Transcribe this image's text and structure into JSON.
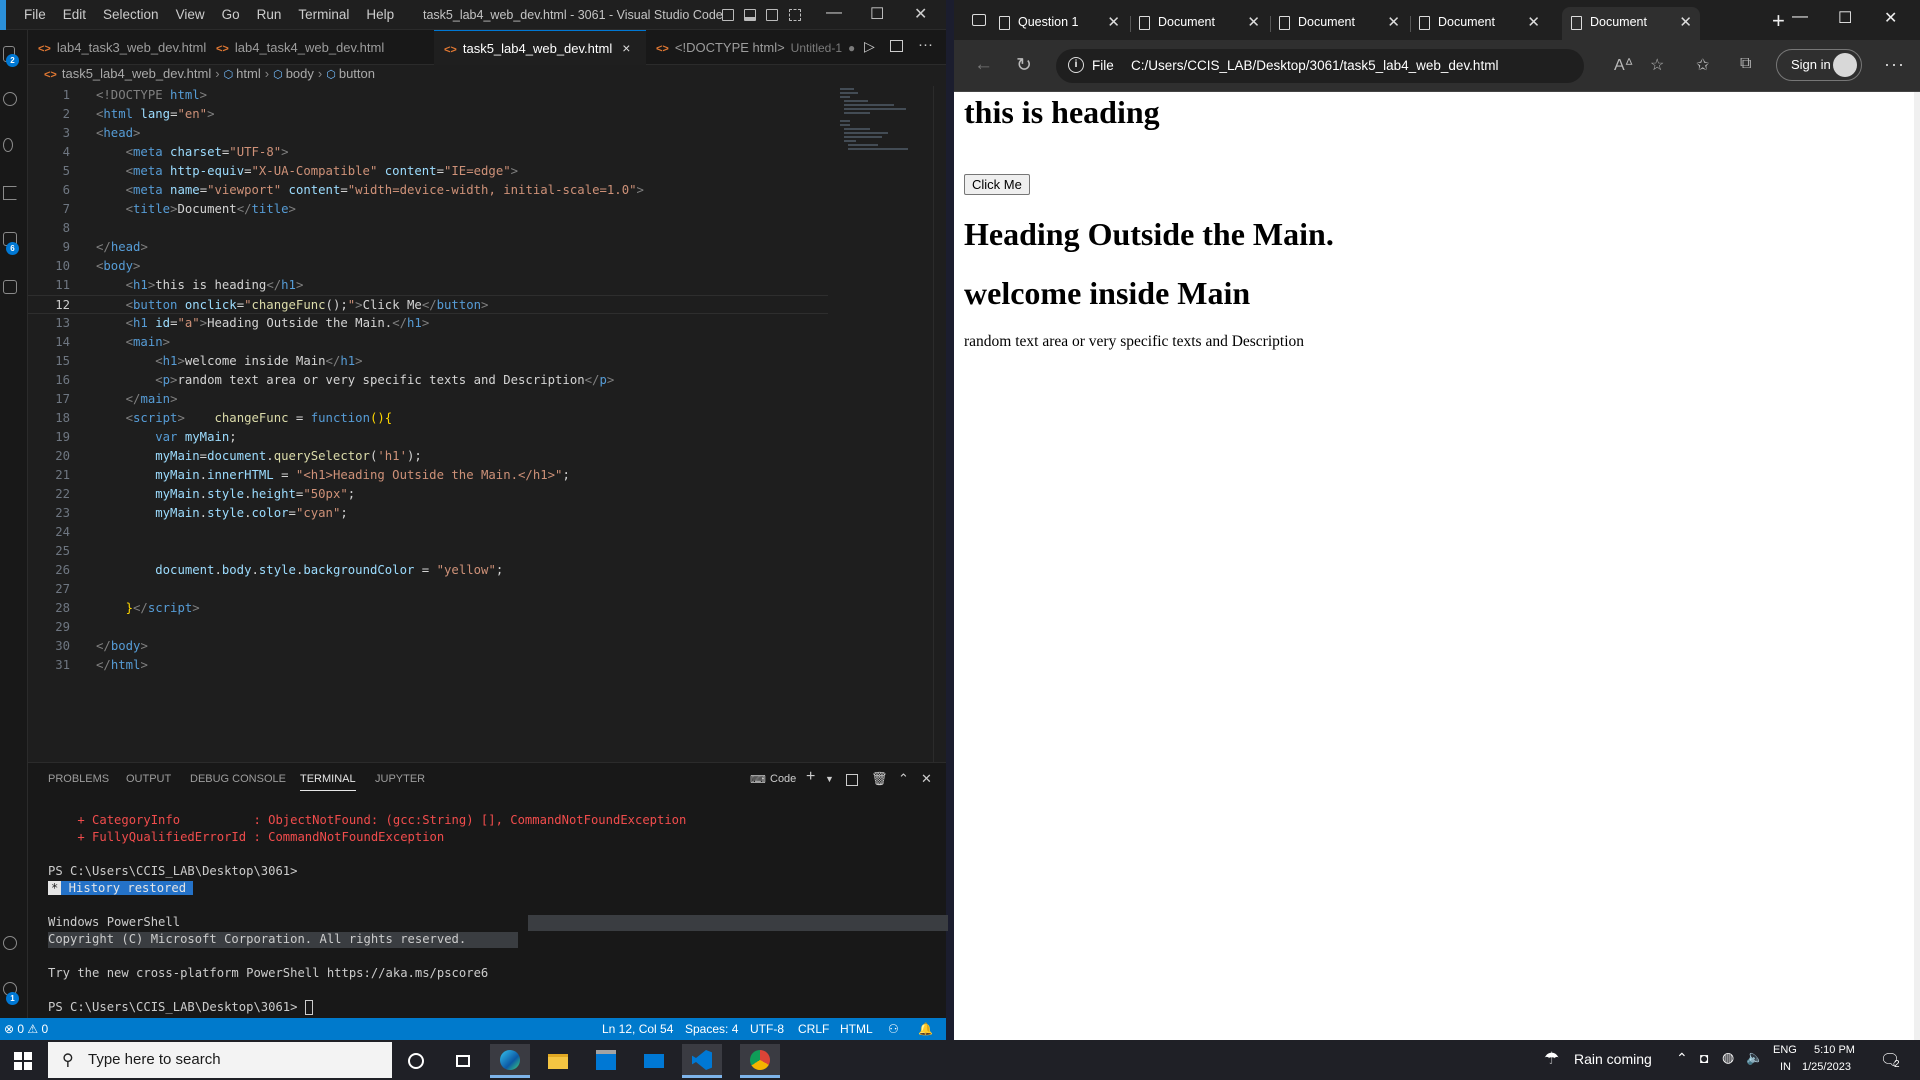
{
  "vscode": {
    "menu": [
      "File",
      "Edit",
      "Selection",
      "View",
      "Go",
      "Run",
      "Terminal",
      "Help"
    ],
    "window_title": "task5_lab4_web_dev.html - 3061 - Visual Studio Code",
    "badges": {
      "source_control": "2",
      "extensions": "6",
      "settings": "1"
    },
    "tabs": [
      {
        "label": "lab4_task3_web_dev.html"
      },
      {
        "label": "lab4_task4_web_dev.html"
      },
      {
        "label": "task5_lab4_web_dev.html",
        "close": "×"
      },
      {
        "label": "<!DOCTYPE html>",
        "sub": "Untitled-1",
        "dirty": "●"
      }
    ],
    "breadcrumb": {
      "file": "task5_lab4_web_dev.html",
      "items": [
        "html",
        "body",
        "button"
      ]
    },
    "code_lines": [
      {
        "n": "1",
        "parts": [
          [
            "t",
            "<!DOCTYPE "
          ],
          [
            "tg",
            "html"
          ],
          [
            "t",
            ">"
          ]
        ]
      },
      {
        "n": "2",
        "parts": [
          [
            "t",
            "<"
          ],
          [
            "tg",
            "html"
          ],
          [
            "at",
            " lang"
          ],
          [
            "tx",
            "="
          ],
          [
            "st",
            "\"en\""
          ],
          [
            "t",
            ">"
          ]
        ]
      },
      {
        "n": "3",
        "parts": [
          [
            "t",
            "<"
          ],
          [
            "tg",
            "head"
          ],
          [
            "t",
            ">"
          ]
        ]
      },
      {
        "n": "4",
        "parts": [
          [
            "tx",
            "    "
          ],
          [
            "t",
            "<"
          ],
          [
            "tg",
            "meta"
          ],
          [
            "at",
            " charset"
          ],
          [
            "tx",
            "="
          ],
          [
            "st",
            "\"UTF-8\""
          ],
          [
            "t",
            ">"
          ]
        ]
      },
      {
        "n": "5",
        "parts": [
          [
            "tx",
            "    "
          ],
          [
            "t",
            "<"
          ],
          [
            "tg",
            "meta"
          ],
          [
            "at",
            " http-equiv"
          ],
          [
            "tx",
            "="
          ],
          [
            "st",
            "\"X-UA-Compatible\""
          ],
          [
            "at",
            " content"
          ],
          [
            "tx",
            "="
          ],
          [
            "st",
            "\"IE=edge\""
          ],
          [
            "t",
            ">"
          ]
        ]
      },
      {
        "n": "6",
        "parts": [
          [
            "tx",
            "    "
          ],
          [
            "t",
            "<"
          ],
          [
            "tg",
            "meta"
          ],
          [
            "at",
            " name"
          ],
          [
            "tx",
            "="
          ],
          [
            "st",
            "\"viewport\""
          ],
          [
            "at",
            " content"
          ],
          [
            "tx",
            "="
          ],
          [
            "st",
            "\"width=device-width, initial-scale=1.0\""
          ],
          [
            "t",
            ">"
          ]
        ]
      },
      {
        "n": "7",
        "parts": [
          [
            "tx",
            "    "
          ],
          [
            "t",
            "<"
          ],
          [
            "tg",
            "title"
          ],
          [
            "t",
            ">"
          ],
          [
            "tx",
            "Document"
          ],
          [
            "t",
            "</"
          ],
          [
            "tg",
            "title"
          ],
          [
            "t",
            ">"
          ]
        ]
      },
      {
        "n": "8",
        "parts": []
      },
      {
        "n": "9",
        "parts": [
          [
            "t",
            "</"
          ],
          [
            "tg",
            "head"
          ],
          [
            "t",
            ">"
          ]
        ]
      },
      {
        "n": "10",
        "parts": [
          [
            "t",
            "<"
          ],
          [
            "tg",
            "body"
          ],
          [
            "t",
            ">"
          ]
        ]
      },
      {
        "n": "11",
        "parts": [
          [
            "tx",
            "    "
          ],
          [
            "t",
            "<"
          ],
          [
            "tg",
            "h1"
          ],
          [
            "t",
            ">"
          ],
          [
            "tx",
            "this is heading"
          ],
          [
            "t",
            "</"
          ],
          [
            "tg",
            "h1"
          ],
          [
            "t",
            ">"
          ]
        ]
      },
      {
        "n": "12",
        "parts": [
          [
            "tx",
            "    "
          ],
          [
            "t",
            "<"
          ],
          [
            "tg",
            "button"
          ],
          [
            "at",
            " onclick"
          ],
          [
            "tx",
            "="
          ],
          [
            "st",
            "\""
          ],
          [
            "fn",
            "changeFunc"
          ],
          [
            "tx",
            "();"
          ],
          [
            "st",
            "\""
          ],
          [
            "t",
            ">"
          ],
          [
            "tx",
            "Click Me"
          ],
          [
            "t",
            "</"
          ],
          [
            "tg",
            "button"
          ],
          [
            "t",
            ">"
          ]
        ]
      },
      {
        "n": "13",
        "parts": [
          [
            "tx",
            "    "
          ],
          [
            "t",
            "<"
          ],
          [
            "tg",
            "h1"
          ],
          [
            "at",
            " id"
          ],
          [
            "tx",
            "="
          ],
          [
            "st",
            "\"a\""
          ],
          [
            "t",
            ">"
          ],
          [
            "tx",
            "Heading Outside the Main."
          ],
          [
            "t",
            "</"
          ],
          [
            "tg",
            "h1"
          ],
          [
            "t",
            ">"
          ]
        ]
      },
      {
        "n": "14",
        "parts": [
          [
            "tx",
            "    "
          ],
          [
            "t",
            "<"
          ],
          [
            "tg",
            "main"
          ],
          [
            "t",
            ">"
          ]
        ]
      },
      {
        "n": "15",
        "parts": [
          [
            "tx",
            "        "
          ],
          [
            "t",
            "<"
          ],
          [
            "tg",
            "h1"
          ],
          [
            "t",
            ">"
          ],
          [
            "tx",
            "welcome inside Main"
          ],
          [
            "t",
            "</"
          ],
          [
            "tg",
            "h1"
          ],
          [
            "t",
            ">"
          ]
        ]
      },
      {
        "n": "16",
        "parts": [
          [
            "tx",
            "        "
          ],
          [
            "t",
            "<"
          ],
          [
            "tg",
            "p"
          ],
          [
            "t",
            ">"
          ],
          [
            "tx",
            "random text area or very specific texts and Description"
          ],
          [
            "t",
            "</"
          ],
          [
            "tg",
            "p"
          ],
          [
            "t",
            ">"
          ]
        ]
      },
      {
        "n": "17",
        "parts": [
          [
            "tx",
            "    "
          ],
          [
            "t",
            "</"
          ],
          [
            "tg",
            "main"
          ],
          [
            "t",
            ">"
          ]
        ]
      },
      {
        "n": "18",
        "parts": [
          [
            "tx",
            "    "
          ],
          [
            "t",
            "<"
          ],
          [
            "tg",
            "script"
          ],
          [
            "t",
            ">"
          ],
          [
            "tx",
            "    "
          ],
          [
            "fn",
            "changeFunc"
          ],
          [
            "tx",
            " = "
          ],
          [
            "kw",
            "function"
          ],
          [
            "br",
            "(){"
          ]
        ]
      },
      {
        "n": "19",
        "parts": [
          [
            "tx",
            "        "
          ],
          [
            "kw",
            "var"
          ],
          [
            "at",
            " myMain"
          ],
          [
            "tx",
            ";"
          ]
        ]
      },
      {
        "n": "20",
        "parts": [
          [
            "tx",
            "        "
          ],
          [
            "at",
            "myMain"
          ],
          [
            "tx",
            "="
          ],
          [
            "at",
            "document"
          ],
          [
            "tx",
            "."
          ],
          [
            "fn",
            "querySelector"
          ],
          [
            "tx",
            "("
          ],
          [
            "st",
            "'h1'"
          ],
          [
            "tx",
            ");"
          ]
        ]
      },
      {
        "n": "21",
        "parts": [
          [
            "tx",
            "        "
          ],
          [
            "at",
            "myMain"
          ],
          [
            "tx",
            "."
          ],
          [
            "at",
            "innerHTML"
          ],
          [
            "tx",
            " = "
          ],
          [
            "st",
            "\"<h1>Heading Outside the Main.</h1>\""
          ],
          [
            "tx",
            ";"
          ]
        ]
      },
      {
        "n": "22",
        "parts": [
          [
            "tx",
            "        "
          ],
          [
            "at",
            "myMain"
          ],
          [
            "tx",
            "."
          ],
          [
            "at",
            "style"
          ],
          [
            "tx",
            "."
          ],
          [
            "at",
            "height"
          ],
          [
            "tx",
            "="
          ],
          [
            "st",
            "\"50px\""
          ],
          [
            "tx",
            ";"
          ]
        ]
      },
      {
        "n": "23",
        "parts": [
          [
            "tx",
            "        "
          ],
          [
            "at",
            "myMain"
          ],
          [
            "tx",
            "."
          ],
          [
            "at",
            "style"
          ],
          [
            "tx",
            "."
          ],
          [
            "at",
            "color"
          ],
          [
            "tx",
            "="
          ],
          [
            "st",
            "\"cyan\""
          ],
          [
            "tx",
            ";"
          ]
        ]
      },
      {
        "n": "24",
        "parts": []
      },
      {
        "n": "25",
        "parts": []
      },
      {
        "n": "26",
        "parts": [
          [
            "tx",
            "        "
          ],
          [
            "at",
            "document"
          ],
          [
            "tx",
            "."
          ],
          [
            "at",
            "body"
          ],
          [
            "tx",
            "."
          ],
          [
            "at",
            "style"
          ],
          [
            "tx",
            "."
          ],
          [
            "at",
            "backgroundColor"
          ],
          [
            "tx",
            " = "
          ],
          [
            "st",
            "\"yellow\""
          ],
          [
            "tx",
            ";"
          ]
        ]
      },
      {
        "n": "27",
        "parts": []
      },
      {
        "n": "28",
        "parts": [
          [
            "tx",
            "    "
          ],
          [
            "br",
            "}"
          ],
          [
            "t",
            "</"
          ],
          [
            "tg",
            "script"
          ],
          [
            "t",
            ">"
          ]
        ]
      },
      {
        "n": "29",
        "parts": []
      },
      {
        "n": "30",
        "parts": [
          [
            "t",
            "</"
          ],
          [
            "tg",
            "body"
          ],
          [
            "t",
            ">"
          ]
        ]
      },
      {
        "n": "31",
        "parts": [
          [
            "t",
            "</"
          ],
          [
            "tg",
            "html"
          ],
          [
            "t",
            ">"
          ]
        ]
      }
    ],
    "current_line": "12",
    "panel": {
      "tabs": [
        "PROBLEMS",
        "OUTPUT",
        "DEBUG CONSOLE",
        "TERMINAL",
        "JUPYTER"
      ],
      "active_tab": "TERMINAL",
      "shell_label": "Code"
    },
    "terminal": {
      "err1": "    + CategoryInfo          : ObjectNotFound: (gcc:String) [], CommandNotFoundException",
      "err2": "    + FullyQualifiedErrorId : CommandNotFoundException",
      "prompt1": "PS C:\\Users\\CCIS_LAB\\Desktop\\3061>",
      "history_star": "*",
      "history": " History restored ",
      "ps_title": "Windows PowerShell",
      "copyright": "Copyright (C) Microsoft Corporation. All rights reserved.",
      "try_new": "Try the new cross-platform PowerShell https://aka.ms/pscore6",
      "prompt2": "PS C:\\Users\\CCIS_LAB\\Desktop\\3061> "
    },
    "status": {
      "problems": "⊗ 0 ⚠ 0",
      "position": "Ln 12, Col 54",
      "spaces": "Spaces: 4",
      "encoding": "UTF-8",
      "eol": "CRLF",
      "language": "HTML"
    }
  },
  "browser": {
    "tabs": [
      "Question 1",
      "Document",
      "Document",
      "Document",
      "Document"
    ],
    "active_tab_index": 4,
    "url_protocol": "File",
    "url": "C:/Users/CCIS_LAB/Desktop/3061/task5_lab4_web_dev.html",
    "sign_in": "Sign in",
    "page": {
      "heading1": "this is heading",
      "button": "Click Me",
      "heading2": "Heading Outside the Main.",
      "heading3": "welcome inside Main",
      "paragraph": "random text area or very specific texts and Description"
    }
  },
  "taskbar": {
    "search_placeholder": "Type here to search",
    "weather": "Rain coming",
    "lang_top": "ENG",
    "lang_bottom": "IN",
    "time": "5:10 PM",
    "date": "1/25/2023",
    "notifications": "2"
  },
  "colors": {
    "vscode_accent": "#007acc",
    "edge_dark": "#202020",
    "taskbar": "#1f2026"
  }
}
